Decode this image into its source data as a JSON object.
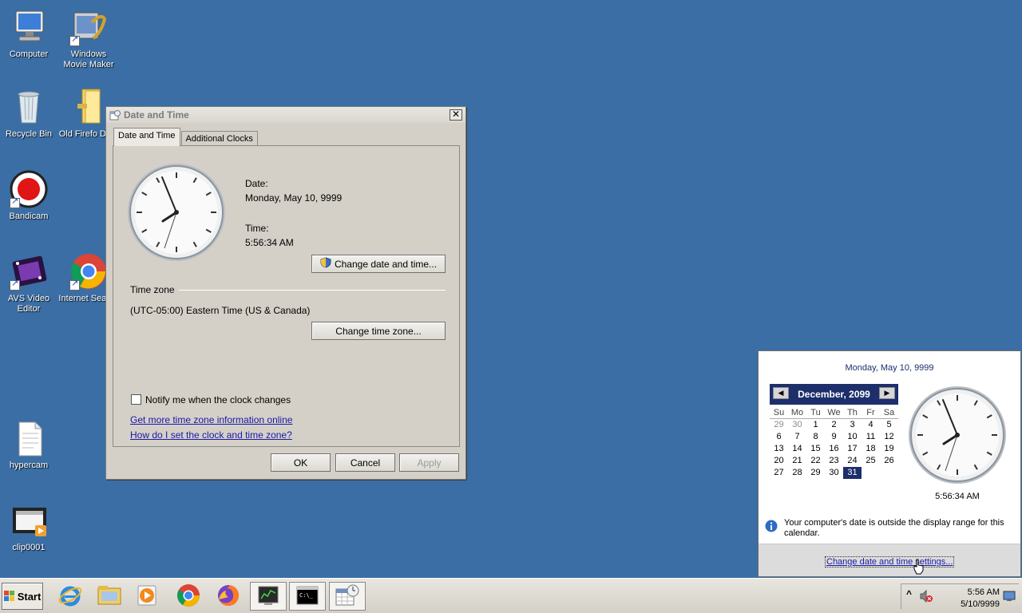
{
  "desktop": {
    "icons": [
      {
        "label": "Computer"
      },
      {
        "label": "Windows Movie Maker"
      },
      {
        "label": "Recycle Bin"
      },
      {
        "label": "Old Firefox Data",
        "display": "Old Firefo Data"
      },
      {
        "label": "Bandicam"
      },
      {
        "label": "AVS Video Editor"
      },
      {
        "label": "Internet Search"
      },
      {
        "label": "hypercam"
      },
      {
        "label": "clip0001"
      }
    ]
  },
  "dialog": {
    "title": "Date and Time",
    "close_label": "✕",
    "tabs": [
      {
        "label": "Date and Time",
        "active": true
      },
      {
        "label": "Additional Clocks",
        "active": false
      }
    ],
    "date_label": "Date:",
    "date_value": "Monday, May 10, 9999",
    "time_label": "Time:",
    "time_value": "5:56:34 AM",
    "change_date_button": "Change date and time...",
    "timezone_heading": "Time zone",
    "timezone_value": "(UTC-05:00) Eastern Time (US & Canada)",
    "change_timezone_button": "Change time zone...",
    "notify_checkbox_label": "Notify me when the clock changes",
    "notify_checked": false,
    "link_timezone_info": "Get more time zone information online",
    "link_how_set": "How do I set the clock and time zone?",
    "ok_label": "OK",
    "cancel_label": "Cancel",
    "apply_label": "Apply"
  },
  "flyout": {
    "date_heading": "Monday, May 10, 9999",
    "month_title": "December, 2099",
    "prev_label": "◀",
    "next_label": "▶",
    "dow": [
      "Su",
      "Mo",
      "Tu",
      "We",
      "Th",
      "Fr",
      "Sa"
    ],
    "weeks": [
      [
        "29",
        "30",
        "1",
        "2",
        "3",
        "4",
        "5"
      ],
      [
        "6",
        "7",
        "8",
        "9",
        "10",
        "11",
        "12"
      ],
      [
        "13",
        "14",
        "15",
        "16",
        "17",
        "18",
        "19"
      ],
      [
        "20",
        "21",
        "22",
        "23",
        "24",
        "25",
        "26"
      ],
      [
        "27",
        "28",
        "29",
        "30",
        "31",
        "",
        ""
      ]
    ],
    "selected_day": "31",
    "time": "5:56:34 AM",
    "info_message": "Your computer's date is outside the display range for this calendar.",
    "settings_link": "Change date and time settings..."
  },
  "taskbar": {
    "start_label": "Start",
    "items": [
      "internet-explorer",
      "windows-explorer",
      "media-player",
      "chrome",
      "firefox",
      "task-manager",
      "command-prompt",
      "date-time-control-panel"
    ],
    "tray_time": "5:56 AM",
    "tray_date": "5/10/9999",
    "show_hidden_label": "^"
  },
  "colors": {
    "desktop": "#3a6ea5",
    "calendar_header": "#1c2f6b",
    "link": "#1a1aa6"
  }
}
